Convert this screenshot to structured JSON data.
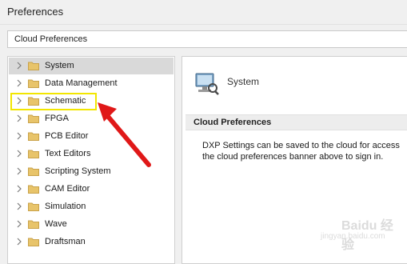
{
  "window": {
    "title": "Preferences"
  },
  "cloud_bar": {
    "label": "Cloud Preferences"
  },
  "tree": {
    "items": [
      {
        "label": "System"
      },
      {
        "label": "Data Management"
      },
      {
        "label": "Schematic"
      },
      {
        "label": "FPGA"
      },
      {
        "label": "PCB Editor"
      },
      {
        "label": "Text Editors"
      },
      {
        "label": "Scripting System"
      },
      {
        "label": "CAM Editor"
      },
      {
        "label": "Simulation"
      },
      {
        "label": "Wave"
      },
      {
        "label": "Draftsman"
      }
    ],
    "selected_index": 0,
    "highlighted_index": 2
  },
  "main": {
    "page_title": "System",
    "section_title": "Cloud Preferences",
    "description_line1": "DXP Settings can be saved to the cloud for access",
    "description_line2": "the cloud preferences banner above to sign in."
  },
  "watermark": {
    "text": "Baidu 经验",
    "sub": "jingyan.baidu.com"
  },
  "colors": {
    "highlight_box": "#f2e600",
    "annotation_arrow": "#e01818",
    "folder": "#e8c46a",
    "selected_row": "#d9d9d9"
  }
}
